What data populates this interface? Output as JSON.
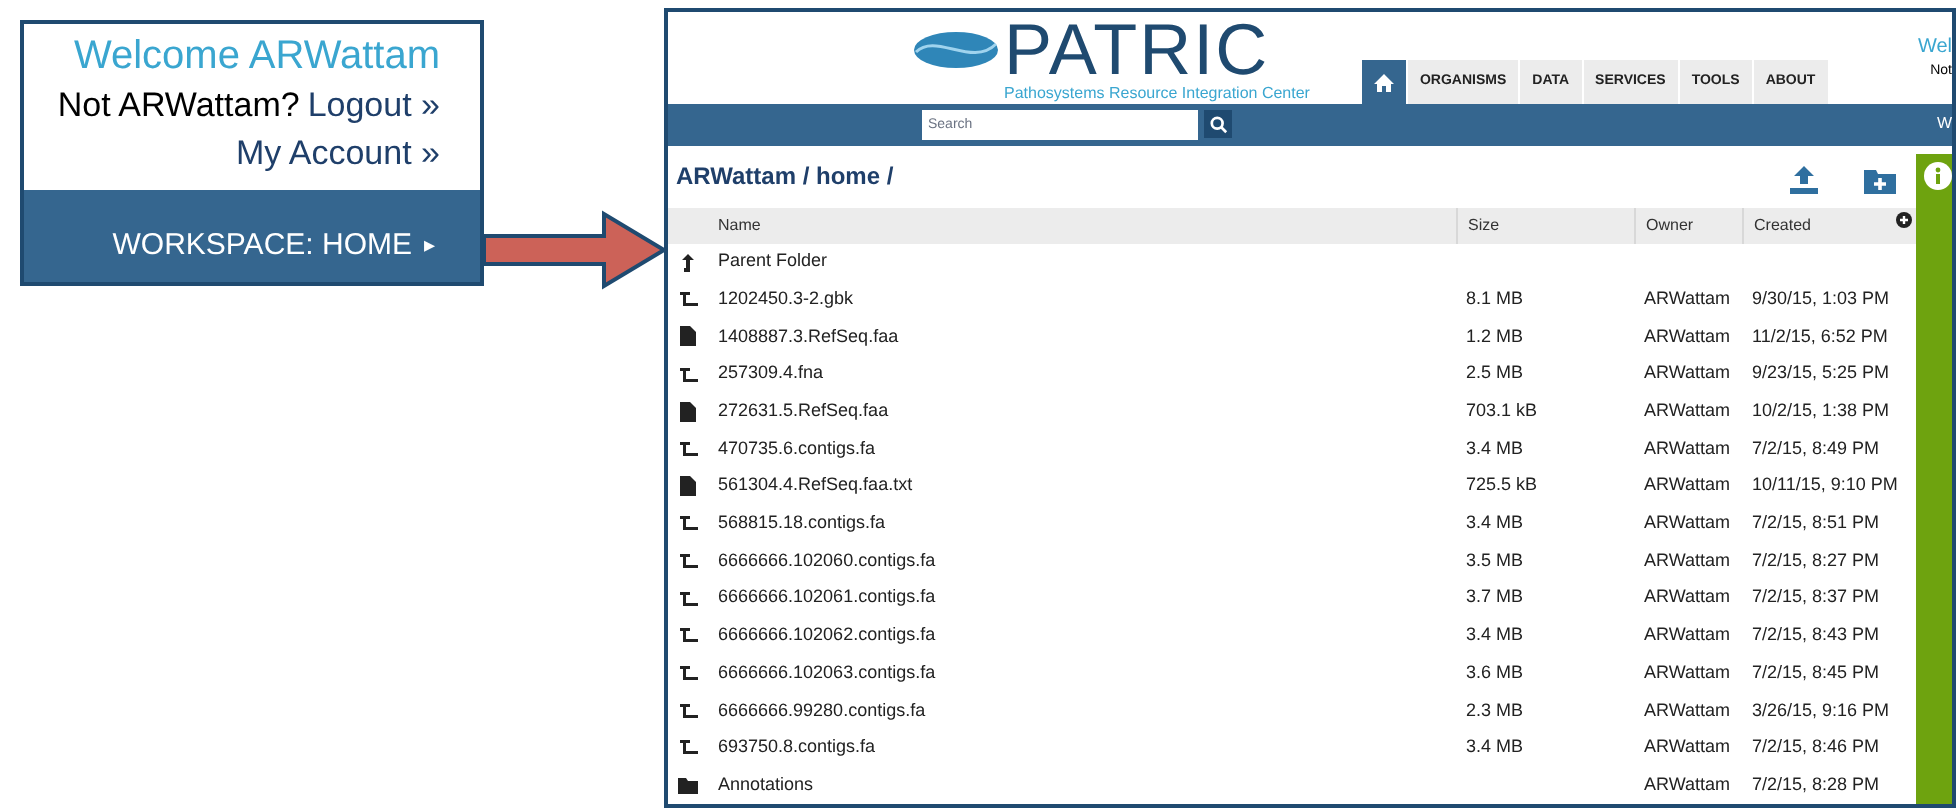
{
  "account_panel": {
    "welcome": "Welcome ARWattam",
    "not_user": "Not ARWattam?",
    "logout": "Logout »",
    "my_account": "My Account »",
    "workspace_link": "WORKSPACE: HOME",
    "workspace_caret": "▸"
  },
  "header": {
    "logo_title": "PATRIC",
    "logo_subtitle": "Pathosystems Resource Integration Center",
    "welcome_cut": "Wel",
    "not_cut": "Not",
    "bar_cut": "W",
    "nav": [
      {
        "kind": "home",
        "selected": true
      },
      {
        "kind": "text",
        "label": "ORGANISMS",
        "selected": false
      },
      {
        "kind": "text",
        "label": "DATA",
        "selected": false
      },
      {
        "kind": "text",
        "label": "SERVICES",
        "selected": false
      },
      {
        "kind": "text",
        "label": "TOOLS",
        "selected": false
      },
      {
        "kind": "text",
        "label": "ABOUT",
        "selected": false
      }
    ],
    "search": {
      "placeholder": "Search"
    }
  },
  "breadcrumb": "ARWattam / home /",
  "table": {
    "columns": [
      "Name",
      "Size",
      "Owner",
      "Created"
    ],
    "rows": [
      {
        "kind": "parent",
        "name": "Parent Folder",
        "size": "",
        "owner": "",
        "created": ""
      },
      {
        "kind": "contigs",
        "name": "1202450.3-2.gbk",
        "size": "8.1 MB",
        "owner": "ARWattam",
        "created": "9/30/15, 1:03 PM"
      },
      {
        "kind": "document",
        "name": "1408887.3.RefSeq.faa",
        "size": "1.2 MB",
        "owner": "ARWattam",
        "created": "11/2/15, 6:52 PM"
      },
      {
        "kind": "contigs",
        "name": "257309.4.fna",
        "size": "2.5 MB",
        "owner": "ARWattam",
        "created": "9/23/15, 5:25 PM"
      },
      {
        "kind": "document",
        "name": "272631.5.RefSeq.faa",
        "size": "703.1 kB",
        "owner": "ARWattam",
        "created": "10/2/15, 1:38 PM"
      },
      {
        "kind": "contigs",
        "name": "470735.6.contigs.fa",
        "size": "3.4 MB",
        "owner": "ARWattam",
        "created": "7/2/15, 8:49 PM"
      },
      {
        "kind": "document",
        "name": "561304.4.RefSeq.faa.txt",
        "size": "725.5 kB",
        "owner": "ARWattam",
        "created": "10/11/15, 9:10 PM"
      },
      {
        "kind": "contigs",
        "name": "568815.18.contigs.fa",
        "size": "3.4 MB",
        "owner": "ARWattam",
        "created": "7/2/15, 8:51 PM"
      },
      {
        "kind": "contigs",
        "name": "6666666.102060.contigs.fa",
        "size": "3.5 MB",
        "owner": "ARWattam",
        "created": "7/2/15, 8:27 PM"
      },
      {
        "kind": "contigs",
        "name": "6666666.102061.contigs.fa",
        "size": "3.7 MB",
        "owner": "ARWattam",
        "created": "7/2/15, 8:37 PM"
      },
      {
        "kind": "contigs",
        "name": "6666666.102062.contigs.fa",
        "size": "3.4 MB",
        "owner": "ARWattam",
        "created": "7/2/15, 8:43 PM"
      },
      {
        "kind": "contigs",
        "name": "6666666.102063.contigs.fa",
        "size": "3.6 MB",
        "owner": "ARWattam",
        "created": "7/2/15, 8:45 PM"
      },
      {
        "kind": "contigs",
        "name": "6666666.99280.contigs.fa",
        "size": "2.3 MB",
        "owner": "ARWattam",
        "created": "3/26/15, 9:16 PM"
      },
      {
        "kind": "contigs",
        "name": "693750.8.contigs.fa",
        "size": "3.4 MB",
        "owner": "ARWattam",
        "created": "7/2/15, 8:46 PM"
      },
      {
        "kind": "folder",
        "name": "Annotations",
        "size": "",
        "owner": "ARWattam",
        "created": "7/2/15, 8:28 PM"
      }
    ]
  }
}
